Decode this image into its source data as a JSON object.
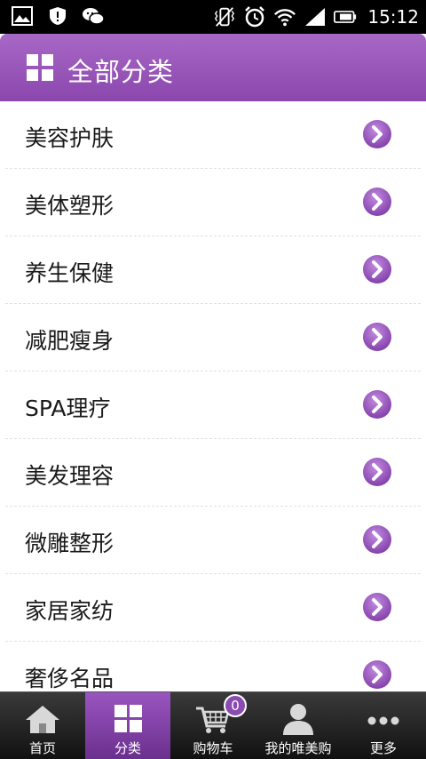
{
  "status_bar": {
    "time": "15:12",
    "icons": [
      "image-icon",
      "shield-icon",
      "wechat-icon",
      "vibrate-icon",
      "alarm-icon",
      "wifi-icon",
      "signal-icon",
      "battery-icon"
    ]
  },
  "header": {
    "title": "全部分类",
    "icon": "grid-icon",
    "gradient": [
      "#a868c6",
      "#8b47ad"
    ]
  },
  "categories": [
    {
      "label": "美容护肤"
    },
    {
      "label": "美体塑形"
    },
    {
      "label": "养生保健"
    },
    {
      "label": "减肥瘦身"
    },
    {
      "label": "SPA理疗"
    },
    {
      "label": "美发理容"
    },
    {
      "label": "微雕整形"
    },
    {
      "label": "家居家纺"
    },
    {
      "label": "奢侈名品"
    }
  ],
  "tabbar": {
    "tabs": [
      {
        "label": "首页",
        "icon": "home-icon",
        "active": false
      },
      {
        "label": "分类",
        "icon": "grid-icon",
        "active": true
      },
      {
        "label": "购物车",
        "icon": "cart-icon",
        "active": false,
        "badge": "0"
      },
      {
        "label": "我的唯美购",
        "icon": "user-icon",
        "active": false
      },
      {
        "label": "更多",
        "icon": "more-icon",
        "active": false
      }
    ]
  },
  "accent_color": "#9b55c1"
}
